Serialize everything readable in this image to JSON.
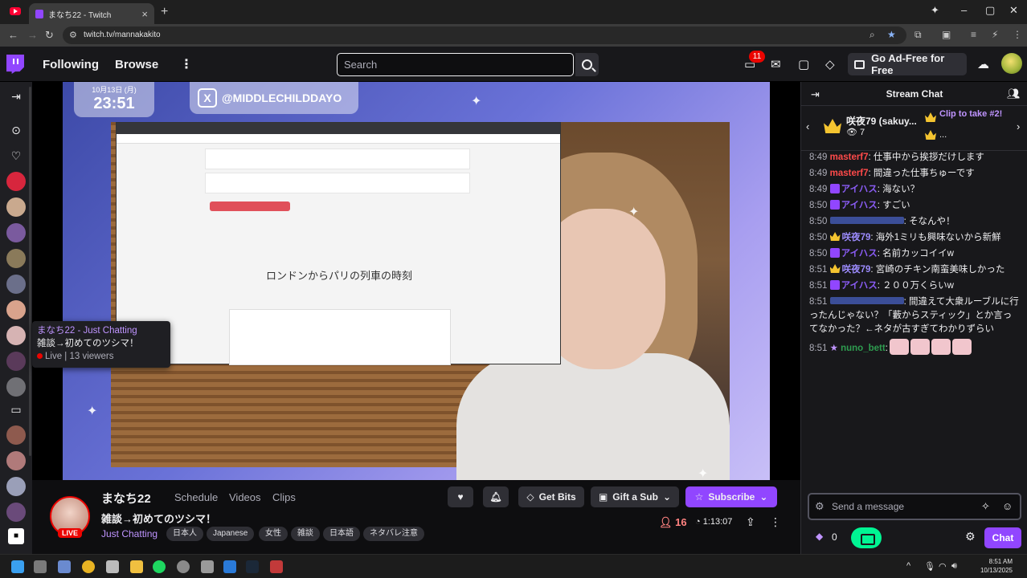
{
  "browser": {
    "tab_title": "まなち22 - Twitch",
    "url": "twitch.tv/mannakakito"
  },
  "topnav": {
    "following": "Following",
    "browse": "Browse",
    "search_placeholder": "Search",
    "notifications_count": "11",
    "ad_free": "Go Ad-Free for Free"
  },
  "tooltip": {
    "line1": "まなち22 - Just Chatting",
    "line2": "雑談→初めてのツシマ！",
    "line3": "Live | 13 viewers"
  },
  "video": {
    "clock_date": "10月13日 (月)",
    "clock_time": "23:51",
    "x_handle": "@MIDDLECHILDDAYO",
    "shared_page_title": "ロンドンからパリの列車の時刻"
  },
  "channel": {
    "name": "まなち22",
    "live_label": "LIVE",
    "tabs": [
      "Schedule",
      "Videos",
      "Clips"
    ],
    "title": "雑談→初めてのツシマ！",
    "category": "Just Chatting",
    "tags": [
      "日本人",
      "Japanese",
      "女性",
      "雑談",
      "日本語",
      "ネタバレ注意"
    ],
    "viewers": "16",
    "uptime": "1:13:07",
    "buttons": {
      "bits": "Get Bits",
      "gift": "Gift a Sub",
      "subscribe": "Subscribe"
    }
  },
  "chat": {
    "header": "Stream Chat",
    "pinned_user": "咲夜79 (sakuy...",
    "pinned_count": "7",
    "pinned_clip": "Clip to take #2!",
    "pinned_more": "...",
    "messages": [
      {
        "time": "8:49",
        "user": "masterf7",
        "color": "#ff4a4a",
        "badge": "",
        "text": ": 仕事中から挨拶だけします"
      },
      {
        "time": "8:49",
        "user": "masterf7",
        "color": "#ff4a4a",
        "badge": "",
        "text": ": 間違った仕事ちゅーです"
      },
      {
        "time": "8:49",
        "user": "アイハス",
        "color": "#8a5cf5",
        "badge": "p",
        "text": ": 海ない？"
      },
      {
        "time": "8:50",
        "user": "アイハス",
        "color": "#8a5cf5",
        "badge": "p",
        "text": ": すごい"
      },
      {
        "time": "8:50",
        "user": "",
        "color": "#5a7bff",
        "badge": "",
        "text": ": そなんや！"
      },
      {
        "time": "8:50",
        "user": "咲夜79",
        "color": "#9d8cff",
        "badge": "c",
        "text": ": 海外1ミリも興味ないから新鮮"
      },
      {
        "time": "8:50",
        "user": "アイハス",
        "color": "#8a5cf5",
        "badge": "p",
        "text": ": 名前カッコイイw"
      },
      {
        "time": "8:51",
        "user": "咲夜79",
        "color": "#9d8cff",
        "badge": "c",
        "text": ": 宮崎のチキン南蛮美味しかった"
      },
      {
        "time": "8:51",
        "user": "アイハス",
        "color": "#8a5cf5",
        "badge": "p",
        "text": ": ２００万くらいw"
      },
      {
        "time": "8:51",
        "user": "",
        "color": "#5a7bff",
        "badge": "",
        "text": ": 間違えて大衆ルーブルに行ったんじゃない？「藪からスティック」とか言ってなかった？←ネタが古すぎてわかりずらい"
      },
      {
        "time": "8:51",
        "user": "nuno_bett",
        "color": "#2e9c4f",
        "badge": "star",
        "text": ":"
      }
    ],
    "input_placeholder": "Send a message",
    "points": "0",
    "send": "Chat"
  },
  "taskbar": {
    "time": "8:51 AM",
    "date": "10/13/2025"
  }
}
